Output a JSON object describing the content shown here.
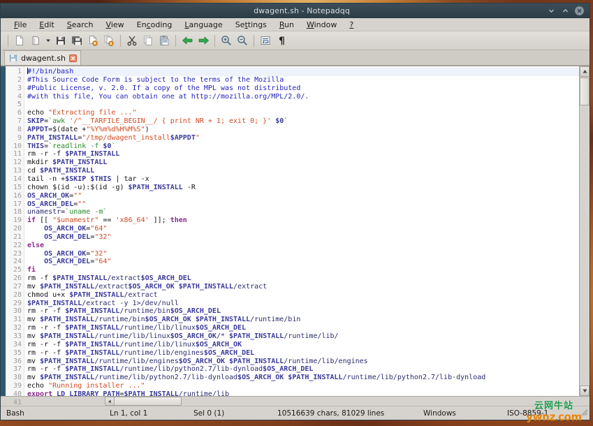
{
  "window": {
    "title": "dwagent.sh - Notepadqq",
    "buttons": [
      {
        "name": "minimize",
        "glyph": "⌄"
      },
      {
        "name": "maximize",
        "glyph": "⌃"
      },
      {
        "name": "close",
        "glyph": "✕"
      }
    ]
  },
  "menubar": {
    "items": [
      {
        "label": "File",
        "mnemonic": "F"
      },
      {
        "label": "Edit",
        "mnemonic": "E"
      },
      {
        "label": "Search",
        "mnemonic": "S"
      },
      {
        "label": "View",
        "mnemonic": "V"
      },
      {
        "label": "Encoding",
        "mnemonic": "c"
      },
      {
        "label": "Language",
        "mnemonic": "L"
      },
      {
        "label": "Settings",
        "mnemonic": "t"
      },
      {
        "label": "Run",
        "mnemonic": "R"
      },
      {
        "label": "Window",
        "mnemonic": "W"
      },
      {
        "label": "?",
        "mnemonic": "?"
      }
    ]
  },
  "toolbar": {
    "buttons": [
      {
        "name": "new-file-icon",
        "tooltip": "New"
      },
      {
        "name": "open-file-icon",
        "tooltip": "Open"
      },
      {
        "name": "open-dropdown-icon",
        "tooltip": "Open recent"
      },
      {
        "name": "save-icon",
        "tooltip": "Save"
      },
      {
        "name": "save-all-icon",
        "tooltip": "Save all"
      },
      {
        "name": "close-file-icon",
        "tooltip": "Close"
      },
      {
        "name": "close-all-files-icon",
        "tooltip": "Close all"
      },
      {
        "name": "cut-icon",
        "tooltip": "Cut"
      },
      {
        "name": "copy-icon",
        "tooltip": "Copy"
      },
      {
        "name": "paste-icon",
        "tooltip": "Paste"
      },
      {
        "name": "undo-icon",
        "tooltip": "Undo"
      },
      {
        "name": "redo-icon",
        "tooltip": "Redo"
      },
      {
        "name": "zoom-in-icon",
        "tooltip": "Zoom in"
      },
      {
        "name": "zoom-out-icon",
        "tooltip": "Zoom out"
      },
      {
        "name": "word-wrap-icon",
        "tooltip": "Word wrap"
      },
      {
        "name": "show-whitespace-icon",
        "tooltip": "Show all characters"
      }
    ]
  },
  "tabs": [
    {
      "label": "dwagent.sh",
      "icon": "file-save-icon",
      "close": "✕",
      "active": true
    }
  ],
  "editor": {
    "first_line": 1,
    "visible_lines": 41,
    "cursor_line": 1,
    "fold_markers": [
      19
    ],
    "lines": [
      {
        "n": 1,
        "tokens": [
          {
            "t": "caret"
          },
          {
            "c": "c-comment",
            "t": "#!/bin/bash"
          }
        ]
      },
      {
        "n": 2,
        "tokens": [
          {
            "c": "c-comment",
            "t": "#This Source Code Form is subject to the terms of the Mozilla"
          }
        ]
      },
      {
        "n": 3,
        "tokens": [
          {
            "c": "c-comment",
            "t": "#Public License, v. 2.0. If a copy of the MPL was not distributed"
          }
        ]
      },
      {
        "n": 4,
        "tokens": [
          {
            "c": "c-comment",
            "t": "#with this file, You can obtain one at http://mozilla.org/MPL/2.0/."
          }
        ]
      },
      {
        "n": 5,
        "tokens": []
      },
      {
        "n": 6,
        "tokens": [
          {
            "c": "c-cmd",
            "t": "echo "
          },
          {
            "c": "c-str",
            "t": "\"Extracting file ...\""
          }
        ]
      },
      {
        "n": 7,
        "tokens": [
          {
            "c": "c-var",
            "t": "SKIP"
          },
          {
            "c": "c-op",
            "t": "="
          },
          {
            "c": "c-bt",
            "t": "`awk "
          },
          {
            "c": "c-str",
            "t": "'/^__TARFILE_BEGIN__/ { print NR + 1; exit 0; }'"
          },
          {
            "c": "c-var",
            "t": " $0"
          },
          {
            "c": "c-bt",
            "t": "`"
          }
        ]
      },
      {
        "n": 8,
        "tokens": [
          {
            "c": "c-var",
            "t": "APPDT"
          },
          {
            "c": "c-op",
            "t": "=$("
          },
          {
            "c": "c-cmd",
            "t": "date "
          },
          {
            "c": "c-op",
            "t": "+"
          },
          {
            "c": "c-str",
            "t": "\"%Y%m%d%H%M%S\""
          },
          {
            "c": "c-op",
            "t": ")"
          }
        ]
      },
      {
        "n": 9,
        "tokens": [
          {
            "c": "c-var",
            "t": "PATH_INSTALL"
          },
          {
            "c": "c-op",
            "t": "="
          },
          {
            "c": "c-str",
            "t": "\"/tmp/dwagent_install"
          },
          {
            "c": "c-var",
            "t": "$APPDT"
          },
          {
            "c": "c-str",
            "t": "\""
          }
        ]
      },
      {
        "n": 10,
        "tokens": [
          {
            "c": "c-var",
            "t": "THIS"
          },
          {
            "c": "c-op",
            "t": "="
          },
          {
            "c": "c-bt",
            "t": "`readlink -f "
          },
          {
            "c": "c-var",
            "t": "$0"
          },
          {
            "c": "c-bt",
            "t": "`"
          }
        ]
      },
      {
        "n": 11,
        "tokens": [
          {
            "c": "c-cmd",
            "t": "rm -r -f "
          },
          {
            "c": "c-var",
            "t": "$PATH_INSTALL"
          }
        ]
      },
      {
        "n": 12,
        "tokens": [
          {
            "c": "c-cmd",
            "t": "mkdir "
          },
          {
            "c": "c-var",
            "t": "$PATH_INSTALL"
          }
        ]
      },
      {
        "n": 13,
        "tokens": [
          {
            "c": "c-cmd",
            "t": "cd "
          },
          {
            "c": "c-var",
            "t": "$PATH_INSTALL"
          }
        ]
      },
      {
        "n": 14,
        "tokens": [
          {
            "c": "c-cmd",
            "t": "tail -n +"
          },
          {
            "c": "c-var",
            "t": "$SKIP $THIS"
          },
          {
            "c": "c-op",
            "t": " | "
          },
          {
            "c": "c-cmd",
            "t": "tar -x"
          }
        ]
      },
      {
        "n": 15,
        "tokens": [
          {
            "c": "c-cmd",
            "t": "chown "
          },
          {
            "c": "c-op",
            "t": "$("
          },
          {
            "c": "c-cmd",
            "t": "id -u"
          },
          {
            "c": "c-op",
            "t": "):$("
          },
          {
            "c": "c-cmd",
            "t": "id -g"
          },
          {
            "c": "c-op",
            "t": ") "
          },
          {
            "c": "c-var",
            "t": "$PATH_INSTALL"
          },
          {
            "c": "c-cmd",
            "t": " -R"
          }
        ]
      },
      {
        "n": 16,
        "tokens": [
          {
            "c": "c-var",
            "t": "OS_ARCH_OK"
          },
          {
            "c": "c-op",
            "t": "="
          },
          {
            "c": "c-str",
            "t": "\"\""
          }
        ]
      },
      {
        "n": 17,
        "tokens": [
          {
            "c": "c-var",
            "t": "OS_ARCH_DEL"
          },
          {
            "c": "c-op",
            "t": "="
          },
          {
            "c": "c-str",
            "t": "\"\""
          }
        ]
      },
      {
        "n": 18,
        "tokens": [
          {
            "c": "c-plain",
            "t": "unamestr"
          },
          {
            "c": "c-op",
            "t": "="
          },
          {
            "c": "c-bt",
            "t": "`uname -m`"
          }
        ]
      },
      {
        "n": 19,
        "tokens": [
          {
            "c": "c-kw",
            "t": "if "
          },
          {
            "c": "c-op",
            "t": "[[ "
          },
          {
            "c": "c-str",
            "t": "\"$unamestr\""
          },
          {
            "c": "c-op",
            "t": " == "
          },
          {
            "c": "c-str",
            "t": "'x86_64'"
          },
          {
            "c": "c-op",
            "t": " ]]; "
          },
          {
            "c": "c-kw",
            "t": "then"
          }
        ]
      },
      {
        "n": 20,
        "tokens": [
          {
            "c": "c-var",
            "t": "    OS_ARCH_OK"
          },
          {
            "c": "c-op",
            "t": "="
          },
          {
            "c": "c-str",
            "t": "\"64\""
          }
        ]
      },
      {
        "n": 21,
        "tokens": [
          {
            "c": "c-var",
            "t": "    OS_ARCH_DEL"
          },
          {
            "c": "c-op",
            "t": "="
          },
          {
            "c": "c-str",
            "t": "\"32\""
          }
        ]
      },
      {
        "n": 22,
        "tokens": [
          {
            "c": "c-kw",
            "t": "else"
          }
        ]
      },
      {
        "n": 23,
        "tokens": [
          {
            "c": "c-var",
            "t": "    OS_ARCH_OK"
          },
          {
            "c": "c-op",
            "t": "="
          },
          {
            "c": "c-str",
            "t": "\"32\""
          }
        ]
      },
      {
        "n": 24,
        "tokens": [
          {
            "c": "c-var",
            "t": "    OS_ARCH_DEL"
          },
          {
            "c": "c-op",
            "t": "="
          },
          {
            "c": "c-str",
            "t": "\"64\""
          }
        ]
      },
      {
        "n": 25,
        "tokens": [
          {
            "c": "c-kw",
            "t": "fi"
          }
        ]
      },
      {
        "n": 26,
        "tokens": [
          {
            "c": "c-cmd",
            "t": "rm -f "
          },
          {
            "c": "c-var",
            "t": "$PATH_INSTALL"
          },
          {
            "c": "c-plain",
            "t": "/extract"
          },
          {
            "c": "c-var",
            "t": "$OS_ARCH_DEL"
          }
        ]
      },
      {
        "n": 27,
        "tokens": [
          {
            "c": "c-cmd",
            "t": "mv "
          },
          {
            "c": "c-var",
            "t": "$PATH_INSTALL"
          },
          {
            "c": "c-plain",
            "t": "/extract"
          },
          {
            "c": "c-var",
            "t": "$OS_ARCH_OK $PATH_INSTALL"
          },
          {
            "c": "c-plain",
            "t": "/extract"
          }
        ]
      },
      {
        "n": 28,
        "tokens": [
          {
            "c": "c-cmd",
            "t": "chmod u+x "
          },
          {
            "c": "c-var",
            "t": "$PATH_INSTALL"
          },
          {
            "c": "c-plain",
            "t": "/extract"
          }
        ]
      },
      {
        "n": 29,
        "tokens": [
          {
            "c": "c-var",
            "t": "$PATH_INSTALL"
          },
          {
            "c": "c-plain",
            "t": "/extract -y 1>/dev/null"
          }
        ]
      },
      {
        "n": 30,
        "tokens": [
          {
            "c": "c-cmd",
            "t": "rm -r -f "
          },
          {
            "c": "c-var",
            "t": "$PATH_INSTALL"
          },
          {
            "c": "c-plain",
            "t": "/runtime/bin"
          },
          {
            "c": "c-var",
            "t": "$OS_ARCH_DEL"
          }
        ]
      },
      {
        "n": 31,
        "tokens": [
          {
            "c": "c-cmd",
            "t": "mv "
          },
          {
            "c": "c-var",
            "t": "$PATH_INSTALL"
          },
          {
            "c": "c-plain",
            "t": "/runtime/bin"
          },
          {
            "c": "c-var",
            "t": "$OS_ARCH_OK $PATH_INSTALL"
          },
          {
            "c": "c-plain",
            "t": "/runtime/bin"
          }
        ]
      },
      {
        "n": 32,
        "tokens": [
          {
            "c": "c-cmd",
            "t": "rm -r -f "
          },
          {
            "c": "c-var",
            "t": "$PATH_INSTALL"
          },
          {
            "c": "c-plain",
            "t": "/runtime/lib/linux"
          },
          {
            "c": "c-var",
            "t": "$OS_ARCH_DEL"
          }
        ]
      },
      {
        "n": 33,
        "tokens": [
          {
            "c": "c-cmd",
            "t": "mv "
          },
          {
            "c": "c-var",
            "t": "$PATH_INSTALL"
          },
          {
            "c": "c-plain",
            "t": "/runtime/lib/linux"
          },
          {
            "c": "c-var",
            "t": "$OS_ARCH_OK"
          },
          {
            "c": "c-plain",
            "t": "/* "
          },
          {
            "c": "c-var",
            "t": "$PATH_INSTALL"
          },
          {
            "c": "c-plain",
            "t": "/runtime/lib/"
          }
        ]
      },
      {
        "n": 34,
        "tokens": [
          {
            "c": "c-cmd",
            "t": "rm -r -f "
          },
          {
            "c": "c-var",
            "t": "$PATH_INSTALL"
          },
          {
            "c": "c-plain",
            "t": "/runtime/lib/linux"
          },
          {
            "c": "c-var",
            "t": "$OS_ARCH_OK"
          }
        ]
      },
      {
        "n": 35,
        "tokens": [
          {
            "c": "c-cmd",
            "t": "rm -r -f "
          },
          {
            "c": "c-var",
            "t": "$PATH_INSTALL"
          },
          {
            "c": "c-plain",
            "t": "/runtime/lib/engines"
          },
          {
            "c": "c-var",
            "t": "$OS_ARCH_DEL"
          }
        ]
      },
      {
        "n": 36,
        "tokens": [
          {
            "c": "c-cmd",
            "t": "mv "
          },
          {
            "c": "c-var",
            "t": "$PATH_INSTALL"
          },
          {
            "c": "c-plain",
            "t": "/runtime/lib/engines"
          },
          {
            "c": "c-var",
            "t": "$OS_ARCH_OK $PATH_INSTALL"
          },
          {
            "c": "c-plain",
            "t": "/runtime/lib/engines"
          }
        ]
      },
      {
        "n": 37,
        "tokens": [
          {
            "c": "c-cmd",
            "t": "rm -r -f "
          },
          {
            "c": "c-var",
            "t": "$PATH_INSTALL"
          },
          {
            "c": "c-plain",
            "t": "/runtime/lib/python2.7/lib-dynload"
          },
          {
            "c": "c-var",
            "t": "$OS_ARCH_DEL"
          }
        ]
      },
      {
        "n": 38,
        "tokens": [
          {
            "c": "c-cmd",
            "t": "mv "
          },
          {
            "c": "c-var",
            "t": "$PATH_INSTALL"
          },
          {
            "c": "c-plain",
            "t": "/runtime/lib/python2.7/lib-dynload"
          },
          {
            "c": "c-var",
            "t": "$OS_ARCH_OK $PATH_INSTALL"
          },
          {
            "c": "c-plain",
            "t": "/runtime/lib/python2.7/lib-dynload"
          }
        ]
      },
      {
        "n": 39,
        "tokens": [
          {
            "c": "c-cmd",
            "t": "echo "
          },
          {
            "c": "c-str",
            "t": "\"Running installer ...\""
          }
        ]
      },
      {
        "n": 40,
        "tokens": [
          {
            "c": "c-kw",
            "t": "export "
          },
          {
            "c": "c-var",
            "t": "LD_LIBRARY_PATH"
          },
          {
            "c": "c-op",
            "t": "="
          },
          {
            "c": "c-var",
            "t": "$PATH_INSTALL"
          },
          {
            "c": "c-plain",
            "t": "/runtime/lib"
          }
        ]
      },
      {
        "n": 41,
        "tokens": []
      }
    ]
  },
  "scrollbars": {
    "vertical": {
      "up_glyph": "▲",
      "down_glyph": "▼"
    },
    "horizontal": {
      "left_glyph": "◀",
      "right_glyph": "▶"
    }
  },
  "statusbar": {
    "language": "Bash",
    "position": "Ln 1, col 1",
    "selection": "Sel 0 (1)",
    "counts": "10516639 chars, 81029 lines",
    "eol": "Windows",
    "encoding": "ISO-8859-1"
  },
  "watermark": {
    "cn": "云网牛站",
    "en_a": "ywnz",
    "en_dot": ".",
    "en_b": "com"
  },
  "colors": {
    "titlebar": "#344550",
    "chrome": "#d6d3ce",
    "accent_strip": "#2e5870",
    "comment": "#2222bb",
    "string": "#d04b22",
    "keyword": "#8a2a8a",
    "variable": "#3a3a9c",
    "backtick": "#2a8a2a",
    "watermark_green": "#1f9b4e",
    "watermark_orange": "#e8870e"
  }
}
